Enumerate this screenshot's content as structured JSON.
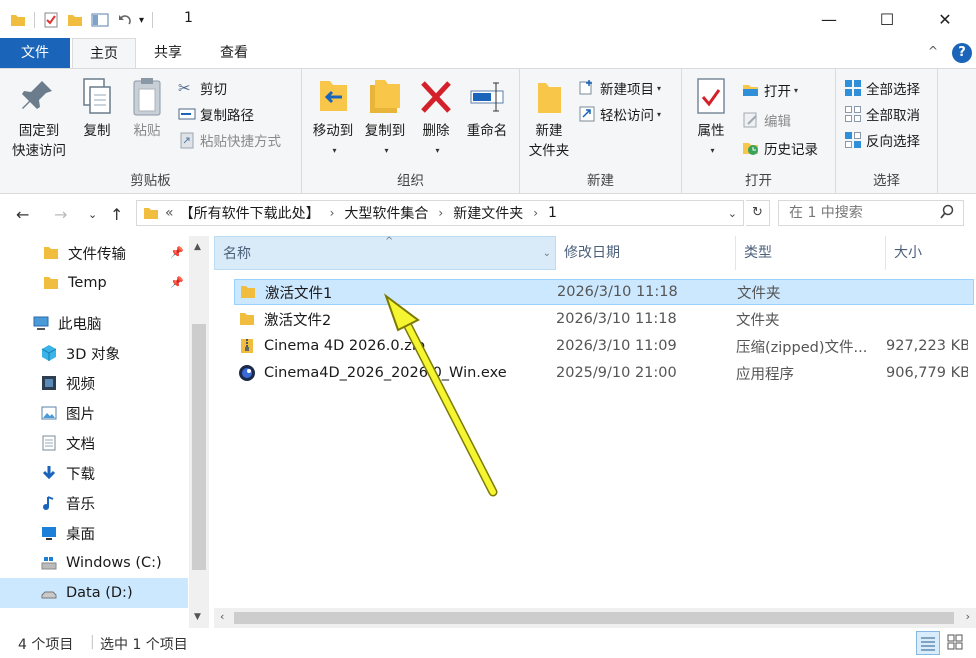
{
  "window": {
    "title": "1",
    "minimize": "—",
    "maximize": "☐",
    "close": "✕"
  },
  "tabs": {
    "file": "文件",
    "home": "主页",
    "share": "共享",
    "view": "查看",
    "help": "?",
    "collapse": "^"
  },
  "ribbon": {
    "clipboard": {
      "label": "剪贴板",
      "pin": "固定到\n快速访问",
      "pin1": "固定到",
      "pin2": "快速访问",
      "copy": "复制",
      "paste": "粘贴",
      "cut": "剪切",
      "copy_path": "复制路径",
      "paste_shortcut": "粘贴快捷方式"
    },
    "organize": {
      "label": "组织",
      "move_to": "移动到",
      "copy_to": "复制到",
      "delete": "删除",
      "rename": "重命名"
    },
    "new": {
      "label": "新建",
      "new_folder1": "新建",
      "new_folder2": "文件夹",
      "new_item": "新建项目",
      "easy_access": "轻松访问"
    },
    "open": {
      "label": "打开",
      "properties": "属性",
      "open": "打开",
      "edit": "编辑",
      "history": "历史记录"
    },
    "select": {
      "label": "选择",
      "select_all": "全部选择",
      "select_none": "全部取消",
      "invert": "反向选择"
    }
  },
  "address": {
    "overflow": "«",
    "crumbs": [
      "【所有软件下载此处】",
      "大型软件集合",
      "新建文件夹",
      "1"
    ],
    "search_placeholder": "在 1 中搜索"
  },
  "nav": {
    "items": [
      {
        "label": "文件传输",
        "pinned": true
      },
      {
        "label": "Temp",
        "pinned": true
      },
      {
        "label": "此电脑"
      },
      {
        "label": "3D 对象"
      },
      {
        "label": "视频"
      },
      {
        "label": "图片"
      },
      {
        "label": "文档"
      },
      {
        "label": "下载"
      },
      {
        "label": "音乐"
      },
      {
        "label": "桌面"
      },
      {
        "label": "Windows (C:)"
      },
      {
        "label": "Data (D:)",
        "selected": true
      }
    ]
  },
  "columns": {
    "name": "名称",
    "date": "修改日期",
    "type": "类型",
    "size": "大小"
  },
  "files": [
    {
      "name": "激活文件1",
      "date": "2026/3/10 11:18",
      "type": "文件夹",
      "size": "",
      "icon": "folder-icon",
      "selected": true
    },
    {
      "name": "激活文件2",
      "date": "2026/3/10 11:18",
      "type": "文件夹",
      "size": "",
      "icon": "folder-icon"
    },
    {
      "name": "Cinema 4D 2026.0.zip",
      "date": "2026/3/10 11:09",
      "type": "压缩(zipped)文件...",
      "size": "927,223 KB",
      "icon": "zip-icon"
    },
    {
      "name": "Cinema4D_2026_2026.0_Win.exe",
      "date": "2025/9/10 21:00",
      "type": "应用程序",
      "size": "906,779 KB",
      "icon": "exe-icon"
    }
  ],
  "status": {
    "count": "4 个项目",
    "selected": "选中 1 个项目"
  },
  "colors": {
    "accent": "#1a65b9",
    "selection": "#cce8ff",
    "folder": "#f8c74a",
    "annotation_arrow": "#f5f532"
  }
}
